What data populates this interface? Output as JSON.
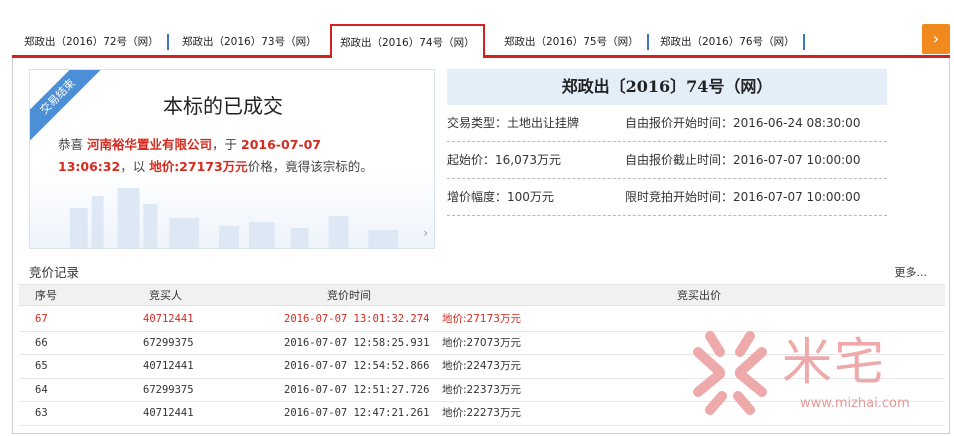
{
  "tabs": [
    {
      "label": "郑政出（2016）72号（网）",
      "active": false
    },
    {
      "label": "郑政出（2016）73号（网）",
      "active": false
    },
    {
      "label": "郑政出（2016）74号（网）",
      "active": true
    },
    {
      "label": "郑政出（2016）75号（网）",
      "active": false
    },
    {
      "label": "郑政出（2016）76号（网）",
      "active": false
    }
  ],
  "tab_next_icon": "chevron-right-icon",
  "result": {
    "ribbon": "交易结束",
    "title": "本标的已成交",
    "congrats": "恭喜",
    "winner": "河南裕华置业有限公司",
    "sep1": "，于",
    "date": "2016-07-07",
    "time": "13:06:32",
    "sep2": "，以",
    "price_label": "地价:27173万元",
    "suffix": "价格，竟得该宗标的。",
    "arrow": "›"
  },
  "info": {
    "title": "郑政出〔2016〕74号（网）",
    "rows": [
      {
        "left": "交易类型：土地出让挂牌",
        "right": "自由报价开始时间：2016-06-24 08:30:00"
      },
      {
        "left": "起始价：16,073万元",
        "right": "自由报价截止时间：2016-07-07 10:00:00"
      },
      {
        "left": "增价幅度：100万元",
        "right": "限时竞拍开始时间：2016-07-07 10:00:00"
      }
    ]
  },
  "records": {
    "heading": "竞价记录",
    "more": "更多...",
    "columns": [
      "序号",
      "竞买人",
      "竞价时间",
      "竞买出价"
    ],
    "rows": [
      {
        "no": "67",
        "bidder": "40712441",
        "time": "2016-07-07 13:01:32.274",
        "price": "地价:27173万元"
      },
      {
        "no": "66",
        "bidder": "67299375",
        "time": "2016-07-07 12:58:25.931",
        "price": "地价:27073万元"
      },
      {
        "no": "65",
        "bidder": "40712441",
        "time": "2016-07-07 12:54:52.866",
        "price": "地价:22473万元"
      },
      {
        "no": "64",
        "bidder": "67299375",
        "time": "2016-07-07 12:51:27.726",
        "price": "地价:22373万元"
      },
      {
        "no": "63",
        "bidder": "40712441",
        "time": "2016-07-07 12:47:21.261",
        "price": "地价:22273万元"
      }
    ]
  },
  "watermark": {
    "brand": "米宅",
    "url": "www.mizhai.com"
  },
  "colors": {
    "accent_red": "#d42020",
    "ribbon_blue": "#4b8fd6",
    "tab_next_orange": "#f08a1e",
    "info_header": "#e3eef9"
  }
}
